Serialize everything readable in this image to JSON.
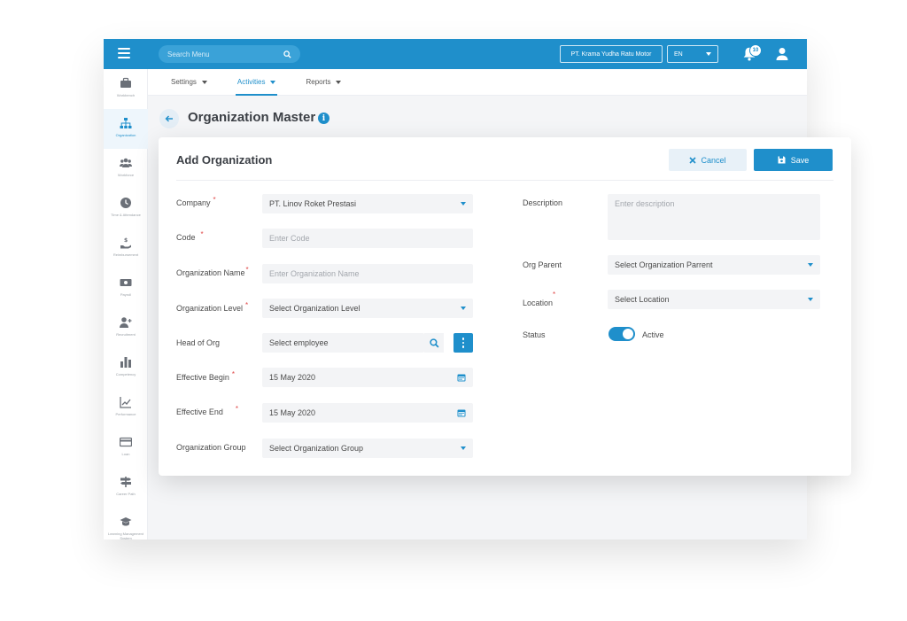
{
  "topbar": {
    "search_placeholder": "Search Menu",
    "company": "PT. Krama Yudha Ratu Motor",
    "language": "EN",
    "notification_count": "10"
  },
  "sidebar": {
    "items": [
      {
        "label": "Workbench",
        "icon": "briefcase-icon"
      },
      {
        "label": "Organization",
        "icon": "org-chart-icon",
        "active": true
      },
      {
        "label": "Workforce",
        "icon": "users-icon"
      },
      {
        "label": "Time & Attendance",
        "icon": "clock-icon"
      },
      {
        "label": "Reimbursement",
        "icon": "hand-dollar-icon"
      },
      {
        "label": "Payroll",
        "icon": "money-icon"
      },
      {
        "label": "Recruitment",
        "icon": "user-plus-icon"
      },
      {
        "label": "Competency",
        "icon": "bar-chart-icon"
      },
      {
        "label": "Performance",
        "icon": "line-chart-icon"
      },
      {
        "label": "Loan",
        "icon": "card-icon"
      },
      {
        "label": "Career Path",
        "icon": "signpost-icon"
      },
      {
        "label": "Learning Management System",
        "icon": "graduation-cap-icon"
      }
    ]
  },
  "subnav": {
    "items": [
      {
        "label": "Settings"
      },
      {
        "label": "Activities",
        "active": true
      },
      {
        "label": "Reports"
      }
    ]
  },
  "page": {
    "title": "Organization Master"
  },
  "form": {
    "title": "Add Organization",
    "cancel_label": "Cancel",
    "save_label": "Save",
    "company": {
      "label": "Company",
      "value": "PT. Linov Roket Prestasi"
    },
    "code": {
      "label": "Code",
      "placeholder": "Enter Code"
    },
    "org_name": {
      "label": "Organization Name",
      "placeholder": "Enter Organization Name"
    },
    "org_level": {
      "label": "Organization Level",
      "value": "Select Organization Level"
    },
    "head_of_org": {
      "label": "Head of Org",
      "value": "Select employee"
    },
    "effective_begin": {
      "label": "Effective Begin",
      "value": "15 May 2020"
    },
    "effective_end": {
      "label": "Effective End",
      "value": "15 May 2020"
    },
    "org_group": {
      "label": "Organization Group",
      "value": "Select Organization Group"
    },
    "description": {
      "label": "Description",
      "placeholder": "Enter description"
    },
    "org_parent": {
      "label": "Org Parent",
      "value": "Select Organization Parrent"
    },
    "location": {
      "label": "Location",
      "value": "Select Location"
    },
    "status": {
      "label": "Status",
      "value": "Active"
    },
    "required_mark": "*"
  },
  "colors": {
    "primary": "#1f8fcb",
    "required": "#e04848"
  }
}
